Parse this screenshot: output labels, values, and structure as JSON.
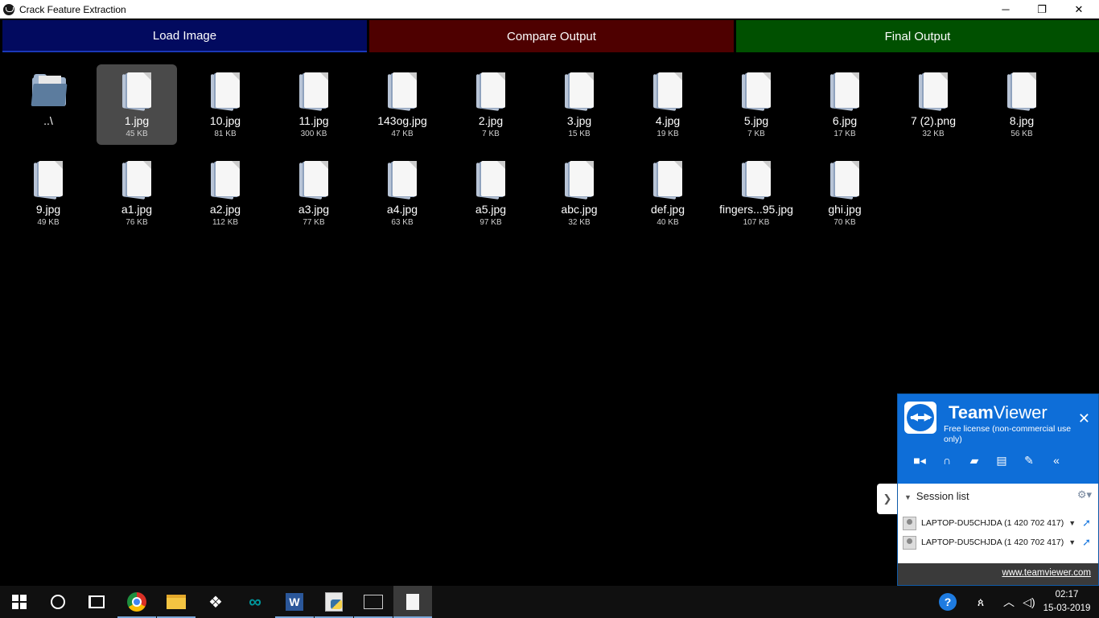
{
  "window": {
    "title": "Crack Feature Extraction",
    "controls": {
      "minimize": "─",
      "maximize": "❐",
      "close": "✕"
    }
  },
  "toolbar": {
    "load": "Load Image",
    "compare": "Compare Output",
    "final": "Final Output",
    "colors": {
      "load": "#020a5f",
      "compare": "#4e0000",
      "final": "#005000"
    }
  },
  "files": [
    {
      "name": "..\\",
      "size": "",
      "icon": "folder-icon"
    },
    {
      "name": "1.jpg",
      "size": "45 KB",
      "icon": "file-icon",
      "selected": true
    },
    {
      "name": "10.jpg",
      "size": "81 KB",
      "icon": "file-icon"
    },
    {
      "name": "11.jpg",
      "size": "300 KB",
      "icon": "file-icon"
    },
    {
      "name": "143og.jpg",
      "size": "47 KB",
      "icon": "file-icon"
    },
    {
      "name": "2.jpg",
      "size": "7 KB",
      "icon": "file-icon"
    },
    {
      "name": "3.jpg",
      "size": "15 KB",
      "icon": "file-icon"
    },
    {
      "name": "4.jpg",
      "size": "19 KB",
      "icon": "file-icon"
    },
    {
      "name": "5.jpg",
      "size": "7 KB",
      "icon": "file-icon"
    },
    {
      "name": "6.jpg",
      "size": "17 KB",
      "icon": "file-icon"
    },
    {
      "name": "7 (2).png",
      "size": "32 KB",
      "icon": "file-icon"
    },
    {
      "name": "8.jpg",
      "size": "56 KB",
      "icon": "file-icon"
    },
    {
      "name": "9.jpg",
      "size": "49 KB",
      "icon": "file-icon"
    },
    {
      "name": "a1.jpg",
      "size": "76 KB",
      "icon": "file-icon"
    },
    {
      "name": "a2.jpg",
      "size": "112 KB",
      "icon": "file-icon"
    },
    {
      "name": "a3.jpg",
      "size": "77 KB",
      "icon": "file-icon"
    },
    {
      "name": "a4.jpg",
      "size": "63 KB",
      "icon": "file-icon"
    },
    {
      "name": "a5.jpg",
      "size": "97 KB",
      "icon": "file-icon"
    },
    {
      "name": "abc.jpg",
      "size": "32 KB",
      "icon": "file-icon"
    },
    {
      "name": "def.jpg",
      "size": "40 KB",
      "icon": "file-icon"
    },
    {
      "name": "fingers...95.jpg",
      "size": "107 KB",
      "icon": "file-icon"
    },
    {
      "name": "ghi.jpg",
      "size": "70 KB",
      "icon": "file-icon"
    }
  ],
  "teamviewer": {
    "brand_bold": "Team",
    "brand_rest": "Viewer",
    "license": "Free license (non-commercial use only)",
    "close": "✕",
    "tools": [
      "video-icon",
      "headset-icon",
      "chat-icon",
      "file-transfer-icon",
      "whiteboard-icon",
      "collapse-icon"
    ],
    "session_list_title": "Session list",
    "sessions": [
      {
        "label": "LAPTOP-DU5CHJDA (1 420 702 417)"
      },
      {
        "label": "LAPTOP-DU5CHJDA (1 420 702 417)"
      }
    ],
    "footer_link": "www.teamviewer.com",
    "accent": "#0e6ed8"
  },
  "taskbar": {
    "apps": [
      "start-icon",
      "cortana-icon",
      "task-view-icon",
      "chrome-icon",
      "file-explorer-icon",
      "dropbox-icon",
      "arduino-icon",
      "word-icon",
      "python-icon",
      "cmd-icon",
      "document-app-icon"
    ],
    "time": "02:17",
    "date": "15-03-2019"
  }
}
